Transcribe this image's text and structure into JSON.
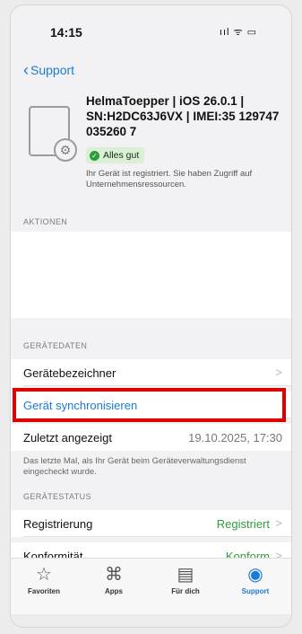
{
  "status_bar": {
    "time": "14:15",
    "icons": "ııl ᯤ ▭"
  },
  "nav": {
    "back_label": "Support"
  },
  "device": {
    "title": "HelmaToepper | iOS 26.0.1 | SN:H2DC63J6VX | IMEI:35 129747 035260 7",
    "badge": "Alles gut",
    "registered_text": "Ihr Gerät ist registriert. Sie haben Zugriff auf Unternehmensressourcen."
  },
  "sections": {
    "actions": "AKTIONEN",
    "device_data": "GERÄTEDATEN",
    "device_status": "GERÄTESTATUS"
  },
  "device_data": {
    "identifier_label": "Gerätebezeichner",
    "sync_label": "Gerät synchronisieren",
    "last_seen_label": "Zuletzt angezeigt",
    "last_seen_value": "19.10.2025, 17:30",
    "last_seen_note": "Das letzte Mal, als Ihr Gerät beim Geräteverwaltungsdienst eingecheckt wurde."
  },
  "device_status": {
    "registration_label": "Registrierung",
    "registration_value": "Registriert",
    "compliance_label": "Konformität",
    "compliance_value": "Konform"
  },
  "tabs": [
    {
      "label": "Favoriten",
      "icon": "star-icon"
    },
    {
      "label": "Apps",
      "icon": "apps-icon"
    },
    {
      "label": "Für dich",
      "icon": "news-icon"
    },
    {
      "label": "Support",
      "icon": "support-icon"
    }
  ],
  "colors": {
    "accent": "#1a7bd6",
    "success": "#2f9c3c",
    "highlight": "#e00000"
  }
}
